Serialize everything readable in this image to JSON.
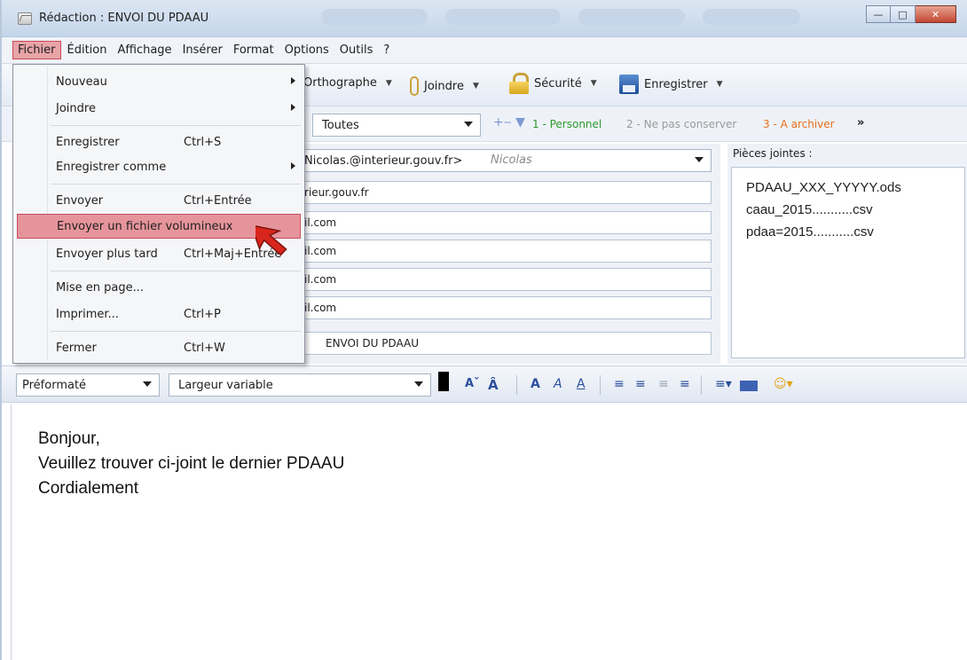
{
  "window": {
    "title": "Rédaction : ENVOI DU PDAAU",
    "controls": [
      "minimize",
      "maximize",
      "close"
    ]
  },
  "menubar": {
    "items": [
      {
        "label": "Fichier",
        "underline": "F",
        "active": true
      },
      {
        "label": "Édition"
      },
      {
        "label": "Affichage"
      },
      {
        "label": "Insérer"
      },
      {
        "label": "Format"
      },
      {
        "label": "Options"
      },
      {
        "label": "Outils"
      },
      {
        "label": "?"
      }
    ]
  },
  "toolbar": {
    "spelling_label": "Orthographe",
    "attach_label": "Joindre",
    "security_label": "Sécurité",
    "save_label": "Enregistrer"
  },
  "filter": {
    "selected": "Toutes",
    "categories": [
      {
        "label": "1 - Personnel",
        "color": "#2d9a2d"
      },
      {
        "label": "2 - Ne pas conserver",
        "color": "#9a9a9a"
      },
      {
        "label": "3 - A archiver",
        "color": "#e8701a"
      }
    ],
    "more": "»"
  },
  "header": {
    "from": "Nicolas.@interieur.gouv.fr>",
    "from_name": "Nicolas",
    "recipients": [
      "rieur.gouv.fr",
      "il.com",
      "il.com",
      "il.com",
      "il.com"
    ],
    "subject": "ENVOI DU PDAAU"
  },
  "attachments": {
    "label": "Pièces jointes :",
    "items": [
      "PDAAU_XXX_YYYYY.ods",
      "caau_2015...........csv",
      "pdaa=2015...........csv"
    ]
  },
  "format": {
    "paragraph": "Préformaté",
    "font": "Largeur variable"
  },
  "body": {
    "lines": [
      "Bonjour,",
      "Veuillez trouver ci-joint le dernier PDAAU",
      "Cordialement"
    ]
  },
  "file_menu": {
    "items": [
      {
        "label": "Nouveau",
        "submenu": true
      },
      {
        "label": "Joindre",
        "submenu": true
      },
      {
        "label": "Enregistrer",
        "shortcut": "Ctrl+S"
      },
      {
        "label": "Enregistrer comme",
        "submenu": true
      },
      {
        "label": "Envoyer",
        "shortcut": "Ctrl+Entrée"
      },
      {
        "label": "Envoyer un fichier volumineux",
        "highlighted": true
      },
      {
        "label": "Envoyer plus tard",
        "shortcut": "Ctrl+Maj+Entrée"
      },
      {
        "label": "Mise en page..."
      },
      {
        "label": "Imprimer...",
        "shortcut": "Ctrl+P"
      },
      {
        "label": "Fermer",
        "shortcut": "Ctrl+W"
      }
    ]
  },
  "colors": {
    "menu_highlight": "#e6949c",
    "cursor_arrow": "#d9261c"
  }
}
